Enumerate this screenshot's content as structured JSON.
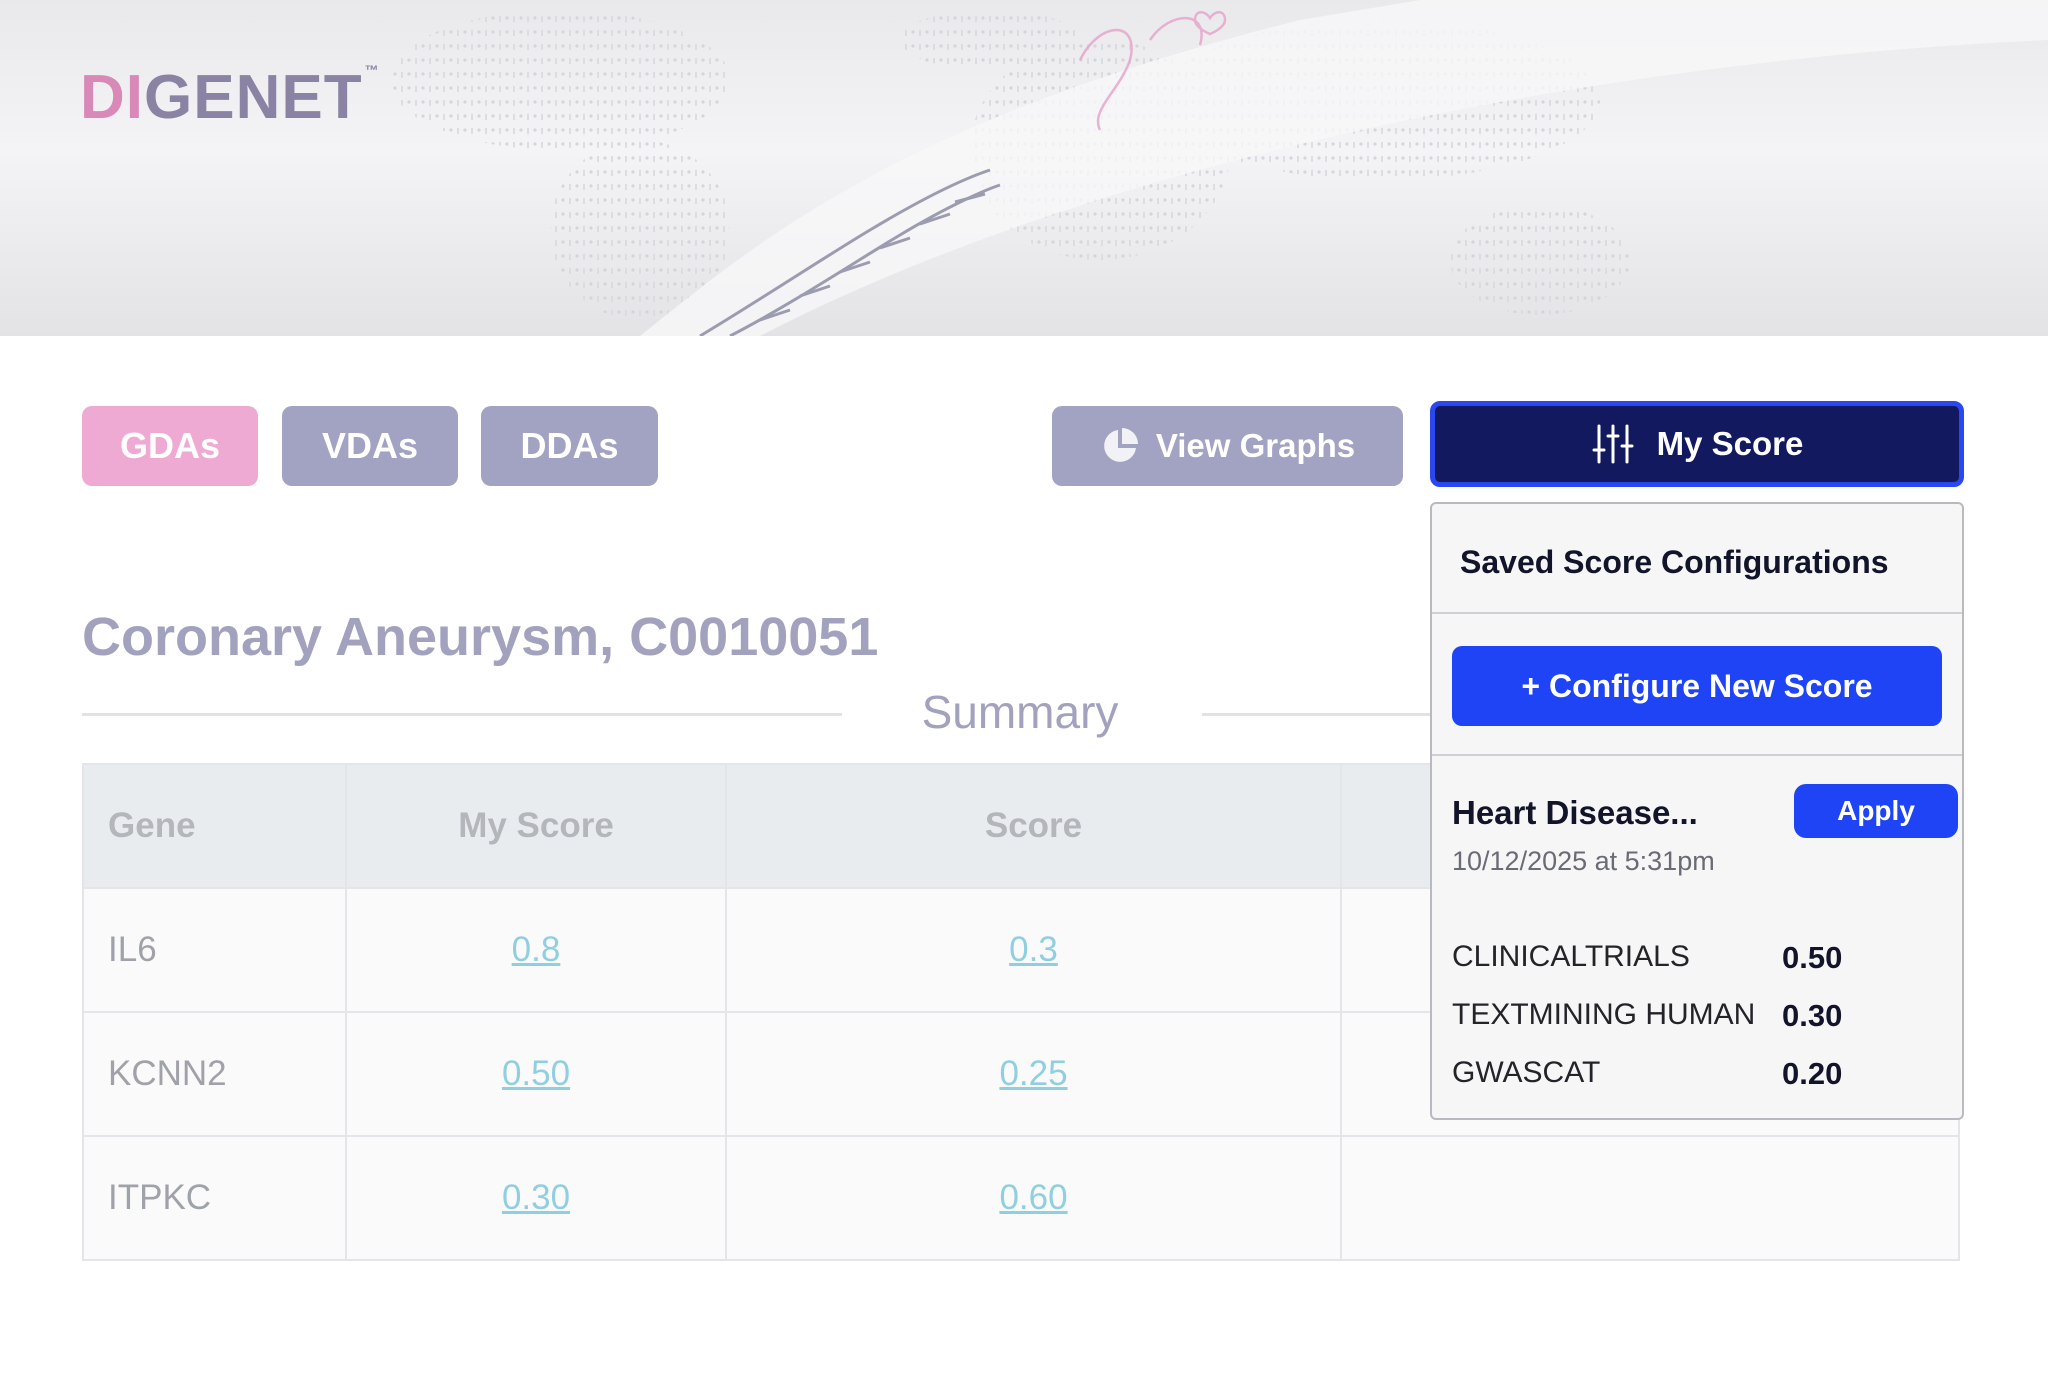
{
  "header": {
    "logo_left": "DI",
    "logo_right": "GENET"
  },
  "tabs": [
    {
      "label": "GDAs"
    },
    {
      "label": "VDAs"
    },
    {
      "label": "DDAs"
    }
  ],
  "toolbar": {
    "view_graphs_label": "View Graphs",
    "my_score_label": "My Score"
  },
  "main": {
    "title": "Coronary Aneurysm, C0010051",
    "section_label": "Summary",
    "table": {
      "columns": [
        "Gene",
        "My Score",
        "Score",
        ""
      ],
      "rows": [
        {
          "gene": "IL6",
          "my_score": "0.8",
          "score": "0.3"
        },
        {
          "gene": "KCNN2",
          "my_score": "0.50",
          "score": "0.25"
        },
        {
          "gene": "ITPKC",
          "my_score": "0.30",
          "score": "0.60"
        }
      ]
    }
  },
  "score_dropdown": {
    "heading": "Saved Score Configurations",
    "configure_label": "+ Configure New Score",
    "configuration": {
      "name": "Heart Disease...",
      "date": "10/12/2025 at 5:31pm",
      "apply_label": "Apply",
      "weights": [
        {
          "source": "CLINICALTRIALS",
          "weight": "0.50"
        },
        {
          "source": "TEXTMINING HUMAN",
          "weight": "0.30"
        },
        {
          "source": "GWASCAT",
          "weight": "0.20"
        }
      ]
    }
  },
  "colors": {
    "active_tab": "#eeaad2",
    "inactive_tab": "#a2a2c2",
    "my_score_bg": "#12195e",
    "primary_blue": "#1f44f5",
    "link": "#90cfe0"
  },
  "icons": {
    "view_graphs": "pie-chart-icon",
    "my_score": "sliders-icon"
  }
}
